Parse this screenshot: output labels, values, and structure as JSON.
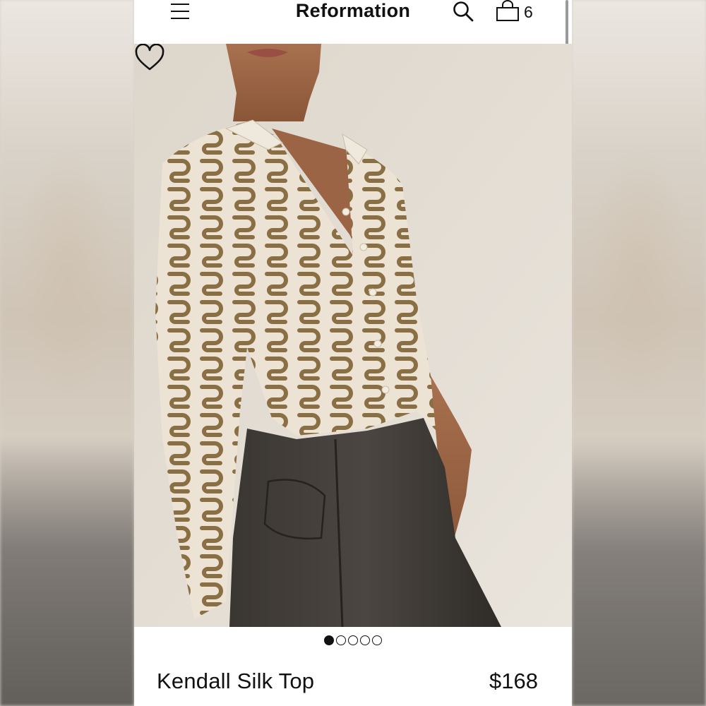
{
  "header": {
    "brand": "Reformation",
    "cart_count": "6",
    "icons": [
      "menu-icon",
      "search-icon",
      "bag-icon"
    ]
  },
  "gallery": {
    "image_count": 5,
    "active_index": 0,
    "favorite_icon": "heart-icon"
  },
  "product": {
    "name": "Kendall Silk Top",
    "price": "$168"
  }
}
